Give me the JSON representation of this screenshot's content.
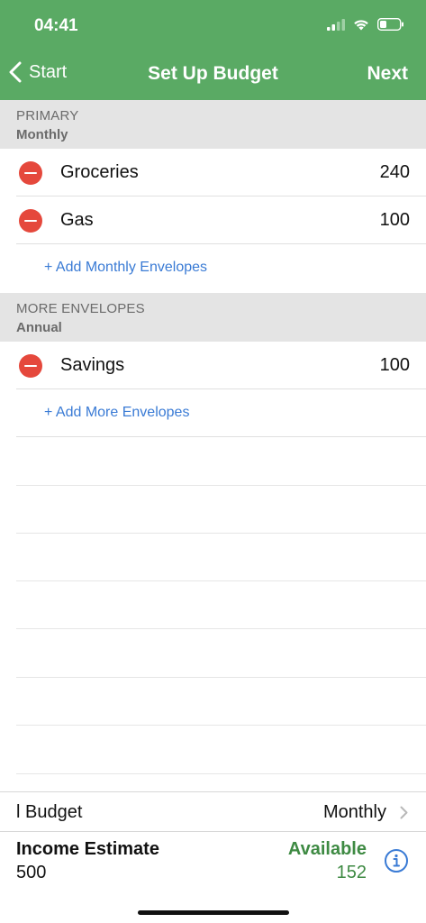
{
  "status_bar": {
    "time": "04:41",
    "icons": [
      "signal-icon",
      "wifi-icon",
      "battery-icon"
    ]
  },
  "nav": {
    "back_label": "Start",
    "title": "Set Up Budget",
    "next_label": "Next"
  },
  "sections": [
    {
      "title": "PRIMARY",
      "subtitle": "Monthly",
      "envelopes": [
        {
          "name": "Groceries",
          "amount": "240"
        },
        {
          "name": "Gas",
          "amount": "100"
        }
      ],
      "add_label": "+ Add Monthly Envelopes"
    },
    {
      "title": "MORE ENVELOPES",
      "subtitle": "Annual",
      "envelopes": [
        {
          "name": "Savings",
          "amount": "100"
        }
      ],
      "add_label": "+ Add More Envelopes"
    }
  ],
  "footer": {
    "budget_label": "l Budget",
    "budget_value": "Monthly",
    "income_label": "Income Estimate",
    "income_value": "500",
    "available_label": "Available",
    "available_value": "152"
  },
  "colors": {
    "accent_green": "#5aaa64",
    "delete_red": "#e5483c",
    "link_blue": "#3a7bd5",
    "available_green": "#3e8a43"
  }
}
